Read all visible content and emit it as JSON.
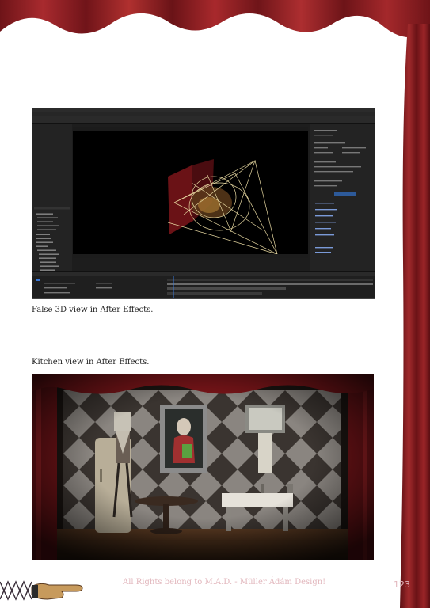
{
  "captions": {
    "false_3d": "False 3D view in After Effects.",
    "kitchen": "Kitchen view in After Effects."
  },
  "footer": {
    "rights": "All Rights belong to M.A.D. - Müller Ádám Design!",
    "page_number": "123"
  },
  "colors": {
    "curtain": "#8a1c20",
    "footer_text": "#e2b7bd"
  },
  "icons": {
    "corner_decoration": "pointing-hand-icon"
  }
}
